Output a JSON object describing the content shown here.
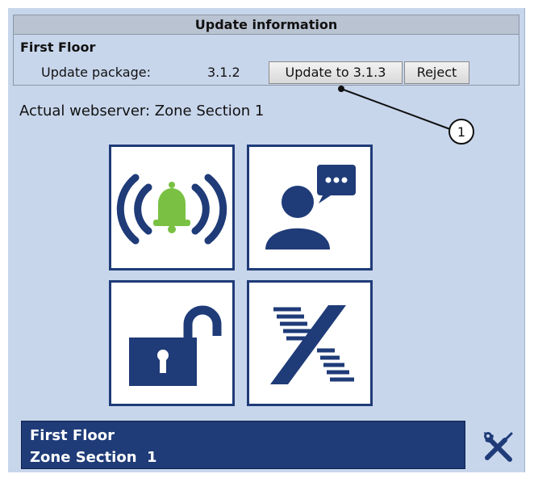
{
  "update_panel": {
    "title": "Update information",
    "floor": "First Floor",
    "package_label": "Update package:",
    "current_version": "3.1.2",
    "update_button": "Update to 3.1.3",
    "reject_button": "Reject"
  },
  "actual_webserver": "Actual webserver: Zone Section 1",
  "callout": {
    "number": "1"
  },
  "tiles": [
    {
      "name": "alarm",
      "icon": "alarm-bell-icon",
      "icon_color": "#7ac143"
    },
    {
      "name": "communication",
      "icon": "person-chat-icon"
    },
    {
      "name": "unlock",
      "icon": "padlock-open-icon"
    },
    {
      "name": "brand",
      "icon": "x-logo-icon"
    }
  ],
  "zone_bar": {
    "line1": "First Floor",
    "line2": "Zone Section  1"
  },
  "colors": {
    "background": "#c8d6ec",
    "accent": "#1f3b78",
    "alarm_bell": "#7ac143"
  }
}
